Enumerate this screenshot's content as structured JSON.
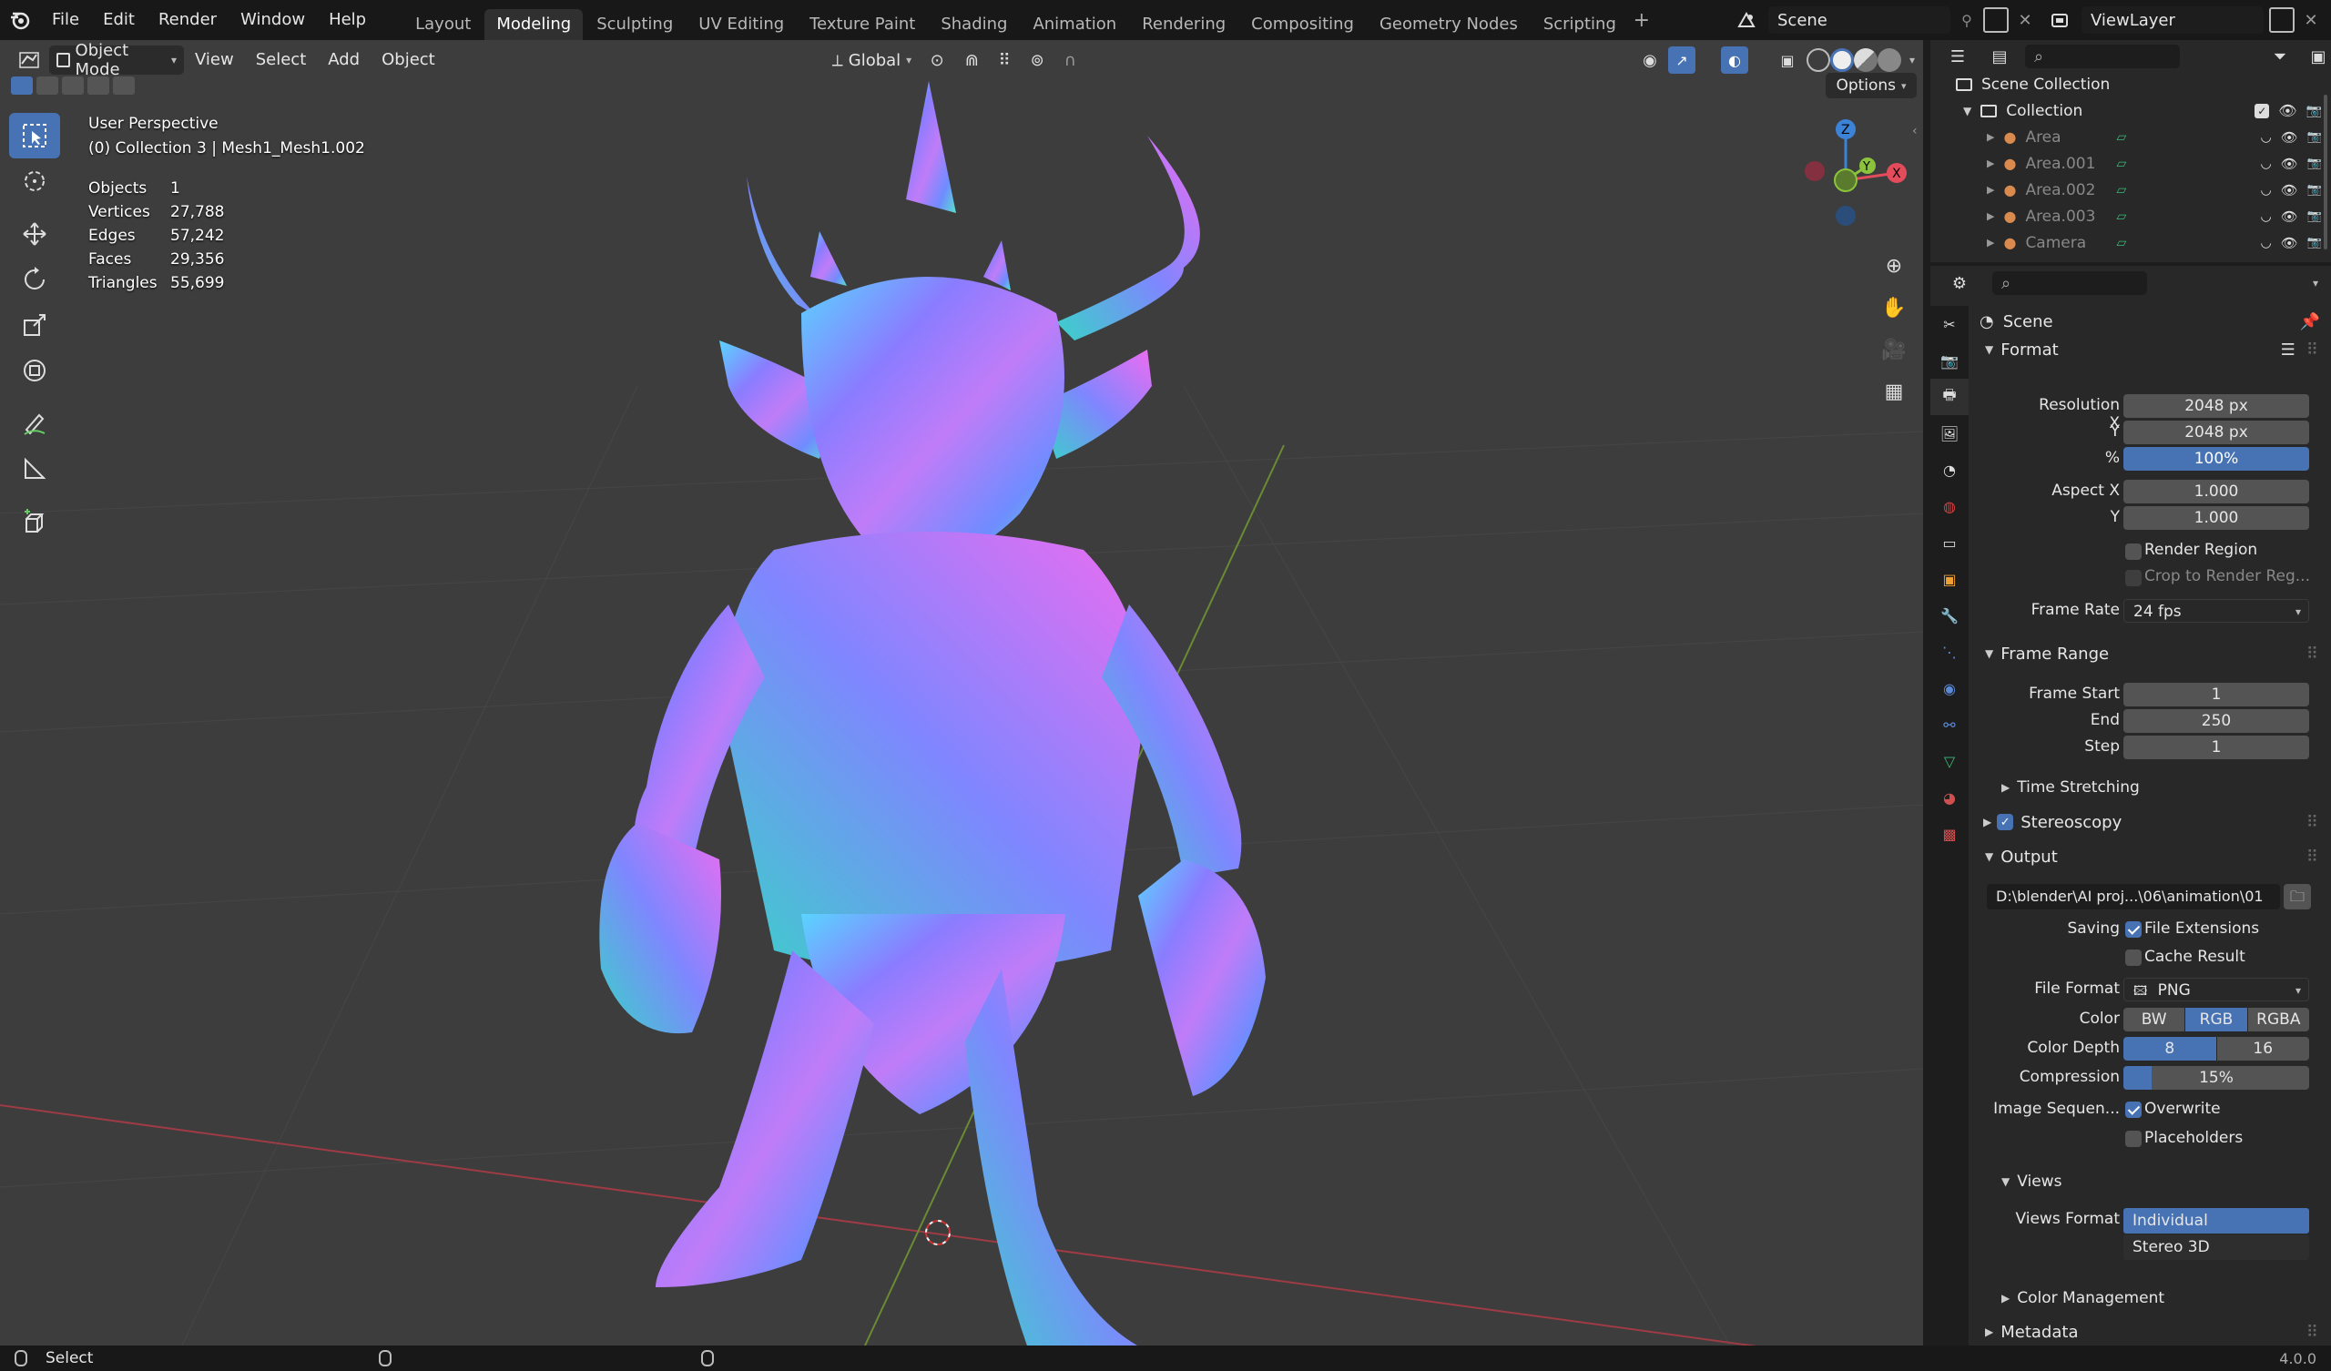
{
  "menu": {
    "file": "File",
    "edit": "Edit",
    "render": "Render",
    "window": "Window",
    "help": "Help"
  },
  "workspaces": [
    "Layout",
    "Modeling",
    "Sculpting",
    "UV Editing",
    "Texture Paint",
    "Shading",
    "Animation",
    "Rendering",
    "Compositing",
    "Geometry Nodes",
    "Scripting"
  ],
  "active_workspace": "Modeling",
  "scene": {
    "name": "Scene"
  },
  "view_layer": {
    "name": "ViewLayer"
  },
  "viewport": {
    "mode": "Object Mode",
    "view_menu": "View",
    "select_menu": "Select",
    "add_menu": "Add",
    "object_menu": "Object",
    "orientation": "Global",
    "options": "Options",
    "perspective": "User Perspective",
    "collection_info": "(0) Collection 3 | Mesh1_Mesh1.002",
    "stats": [
      {
        "label": "Objects",
        "value": "1"
      },
      {
        "label": "Vertices",
        "value": "27,788"
      },
      {
        "label": "Edges",
        "value": "57,242"
      },
      {
        "label": "Faces",
        "value": "29,356"
      },
      {
        "label": "Triangles",
        "value": "55,699"
      }
    ],
    "gizmo": {
      "z": "Z",
      "y": "Y",
      "x": "X"
    }
  },
  "outliner": {
    "scene_collection": "Scene Collection",
    "collection": "Collection",
    "items": [
      "Area",
      "Area.001",
      "Area.002",
      "Area.003",
      "Camera"
    ]
  },
  "properties": {
    "context": "Scene",
    "format": {
      "title": "Format",
      "resolution_x_label": "Resolution X",
      "resolution_x": "2048 px",
      "resolution_y_label": "Y",
      "resolution_y": "2048 px",
      "percent_label": "%",
      "percent": "100%",
      "aspect_x_label": "Aspect X",
      "aspect_x": "1.000",
      "aspect_y_label": "Y",
      "aspect_y": "1.000",
      "render_region": "Render Region",
      "crop": "Crop to Render Reg...",
      "frame_rate_label": "Frame Rate",
      "frame_rate": "24 fps"
    },
    "frame_range": {
      "title": "Frame Range",
      "start_label": "Frame Start",
      "start": "1",
      "end_label": "End",
      "end": "250",
      "step_label": "Step",
      "step": "1",
      "time_stretching": "Time Stretching"
    },
    "stereoscopy": "Stereoscopy",
    "output": {
      "title": "Output",
      "path": "D:\\blender\\AI proj...\\06\\animation\\01",
      "saving_label": "Saving",
      "file_extensions": "File Extensions",
      "cache_result": "Cache Result",
      "file_format_label": "File Format",
      "file_format": "PNG",
      "color_label": "Color",
      "color_options": [
        "BW",
        "RGB",
        "RGBA"
      ],
      "color_selected": "RGB",
      "depth_label": "Color Depth",
      "depth_options": [
        "8",
        "16"
      ],
      "depth_selected": "8",
      "compression_label": "Compression",
      "compression": "15%",
      "compression_value": 0.15,
      "image_seq_label": "Image Sequen...",
      "overwrite": "Overwrite",
      "placeholders": "Placeholders",
      "views_title": "Views",
      "views_format_label": "Views Format",
      "views_options": [
        "Individual",
        "Stereo 3D"
      ],
      "views_selected": "Individual"
    },
    "color_management": "Color Management",
    "metadata": "Metadata"
  },
  "status": {
    "select": "Select",
    "version": "4.0.0"
  },
  "colors": {
    "accent": "#4772b3",
    "x_axis": "#e44c5c",
    "y_axis": "#8bc43c",
    "z_axis": "#3c82d6"
  }
}
